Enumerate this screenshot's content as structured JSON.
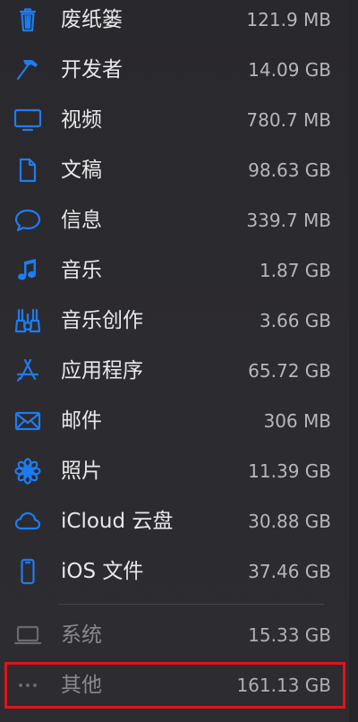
{
  "items": [
    {
      "label": "废纸篓",
      "size": "121.9 MB",
      "icon": "trash-icon"
    },
    {
      "label": "开发者",
      "size": "14.09 GB",
      "icon": "hammer-icon"
    },
    {
      "label": "视频",
      "size": "780.7 MB",
      "icon": "display-icon"
    },
    {
      "label": "文稿",
      "size": "98.63 GB",
      "icon": "document-icon"
    },
    {
      "label": "信息",
      "size": "339.7 MB",
      "icon": "message-bubble-icon"
    },
    {
      "label": "音乐",
      "size": "1.87 GB",
      "icon": "music-note-icon"
    },
    {
      "label": "音乐创作",
      "size": "3.66 GB",
      "icon": "guitars-icon"
    },
    {
      "label": "应用程序",
      "size": "65.72 GB",
      "icon": "app-store-icon"
    },
    {
      "label": "邮件",
      "size": "306 MB",
      "icon": "envelope-icon"
    },
    {
      "label": "照片",
      "size": "11.39 GB",
      "icon": "photos-flower-icon"
    },
    {
      "label": "iCloud 云盘",
      "size": "30.88 GB",
      "icon": "icloud-icon"
    },
    {
      "label": "iOS 文件",
      "size": "37.46 GB",
      "icon": "iphone-icon"
    },
    {
      "label": "系统",
      "size": "15.33 GB",
      "icon": "laptop-icon"
    },
    {
      "label": "其他",
      "size": "161.13 GB",
      "icon": "ellipsis-icon"
    }
  ],
  "colors": {
    "accent": "#1e7cf2",
    "highlight_border": "#e0131a",
    "background": "#2b2a2e"
  }
}
